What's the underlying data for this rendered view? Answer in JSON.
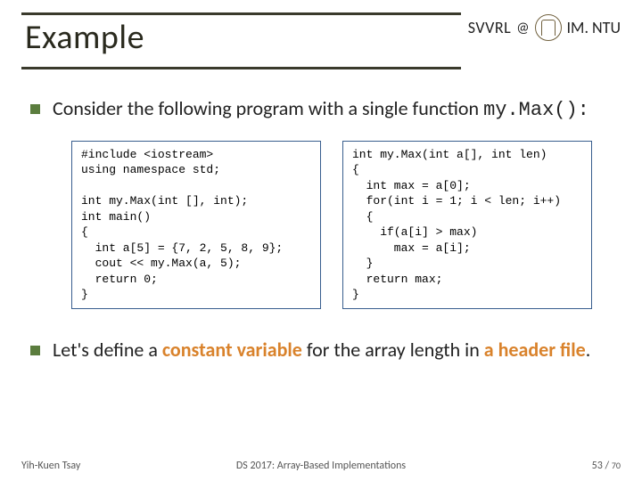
{
  "header": {
    "title": "Example",
    "org": "SVVRL",
    "at": "@",
    "dept": "IM. NTU"
  },
  "bullet1": {
    "prefix": "Consider the following program with a single function ",
    "func": "my.Max():"
  },
  "code_left": "#include <iostream>\nusing namespace std;\n\nint my.Max(int [], int);\nint main()\n{\n  int a[5] = {7, 2, 5, 8, 9};\n  cout << my.Max(a, 5);\n  return 0;\n}",
  "code_right": "int my.Max(int a[], int len)\n{\n  int max = a[0];\n  for(int i = 1; i < len; i++)\n  {\n    if(a[i] > max)\n      max = a[i];\n  }\n  return max;\n}",
  "bullet2": {
    "t1": "Let's define a ",
    "h1": "constant variable",
    "t2": " for the array length in ",
    "h2": "a header file",
    "t3": "."
  },
  "footer": {
    "left": "Yih-Kuen Tsay",
    "mid": "DS 2017: Array-Based Implementations",
    "page": "53",
    "sep": " / ",
    "total": "70"
  }
}
